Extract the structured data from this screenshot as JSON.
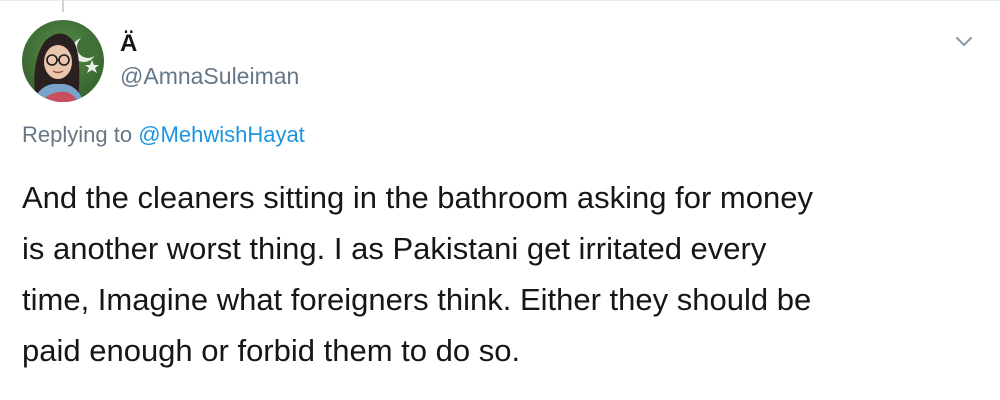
{
  "tweet": {
    "display_name": "Ä",
    "handle": "@AmnaSuleiman",
    "replying_prefix": "Replying to ",
    "replying_to": "@MehwishHayat",
    "text": "And the cleaners sitting in the bathroom asking for money\nis another worst thing. I as Pakistani get irritated every\ntime, Imagine what foreigners think. Either they should be\npaid enough or forbid them to do so.",
    "avatar_icon": "profile-avatar",
    "menu_icon": "chevron-down-icon"
  },
  "colors": {
    "text_primary": "#14171a",
    "text_secondary": "#657786",
    "link": "#1b95e0",
    "divider": "#e6ecf0"
  }
}
